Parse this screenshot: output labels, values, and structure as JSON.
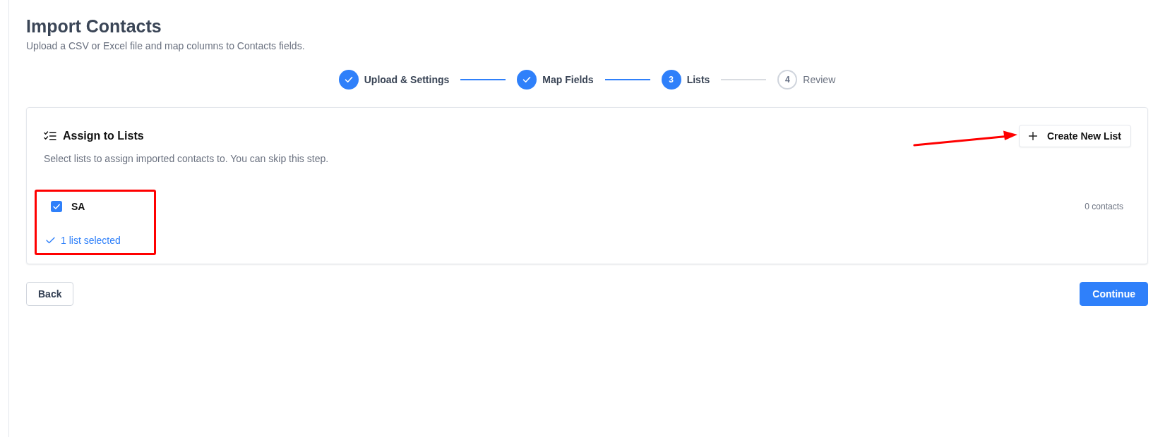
{
  "page": {
    "title": "Import Contacts",
    "subtitle": "Upload a CSV or Excel file and map columns to Contacts fields."
  },
  "steps": [
    {
      "label": "Upload & Settings",
      "completed": true,
      "disabled": false
    },
    {
      "label": "Map Fields",
      "completed": true,
      "disabled": false
    },
    {
      "label": "Lists",
      "number": "3",
      "completed": false,
      "disabled": false
    },
    {
      "label": "Review",
      "number": "4",
      "completed": false,
      "disabled": true
    }
  ],
  "card": {
    "title": "Assign to Lists",
    "description": "Select lists to assign imported contacts to. You can skip this step.",
    "create_button": "Create New List",
    "create_button_annotation": {
      "kind": "arrow"
    },
    "lists": [
      {
        "name": "SA",
        "checked": true,
        "count": "0 contacts"
      }
    ],
    "selection_summary": "1 list selected",
    "lists_annotation": {
      "kind": "frame"
    }
  },
  "footer": {
    "back_button": "Back",
    "continue_button": "Continue"
  }
}
